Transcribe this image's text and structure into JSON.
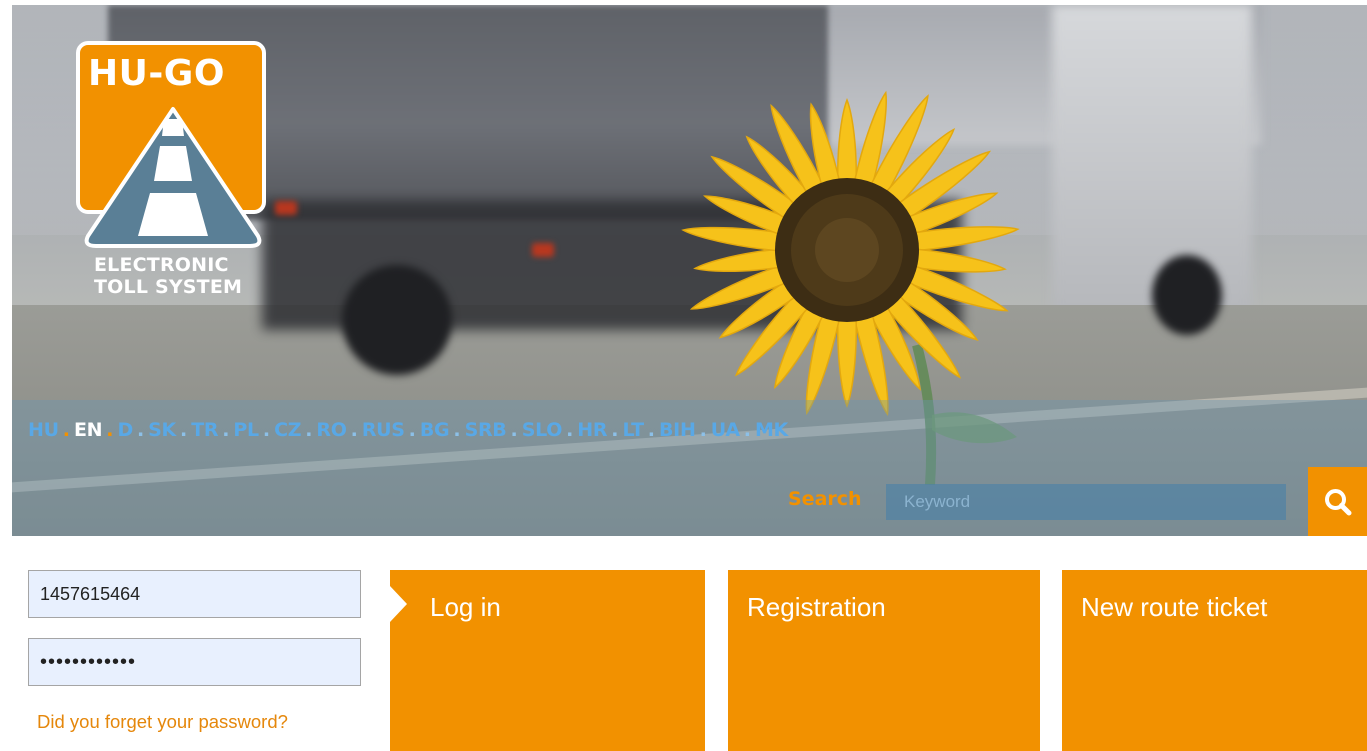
{
  "header": {
    "logo": {
      "name": "HU-GO",
      "subtitle_line1": "ELECTRONIC",
      "subtitle_line2": "TOLL SYSTEM"
    },
    "languages": [
      {
        "label": "HU",
        "active": false
      },
      {
        "label": "EN",
        "active": true
      },
      {
        "label": "D",
        "active": false
      },
      {
        "label": "SK",
        "active": false
      },
      {
        "label": "TR",
        "active": false
      },
      {
        "label": "PL",
        "active": false
      },
      {
        "label": "CZ",
        "active": false
      },
      {
        "label": "RO",
        "active": false
      },
      {
        "label": "RUS",
        "active": false
      },
      {
        "label": "BG",
        "active": false
      },
      {
        "label": "SRB",
        "active": false
      },
      {
        "label": "SLO",
        "active": false
      },
      {
        "label": "HR",
        "active": false
      },
      {
        "label": "LT",
        "active": false
      },
      {
        "label": "BIH",
        "active": false
      },
      {
        "label": "UA",
        "active": false
      },
      {
        "label": "MK",
        "active": false
      }
    ],
    "language_separator": ".",
    "search": {
      "label": "Search",
      "placeholder": "Keyword",
      "button_icon": "magnifier-icon"
    }
  },
  "login": {
    "username_value": "1457615464",
    "password_value": "••••••••••••",
    "forgot_link": "Did you forget your password?"
  },
  "tiles": [
    {
      "label": "Log in",
      "icon": "arrow-right-marker"
    },
    {
      "label": "Registration"
    },
    {
      "label": "New route ticket"
    }
  ],
  "colors": {
    "accent_orange": "#f29100",
    "language_link": "#59a8e6",
    "language_active": "#ffffff",
    "input_background": "#e8f0fe"
  }
}
